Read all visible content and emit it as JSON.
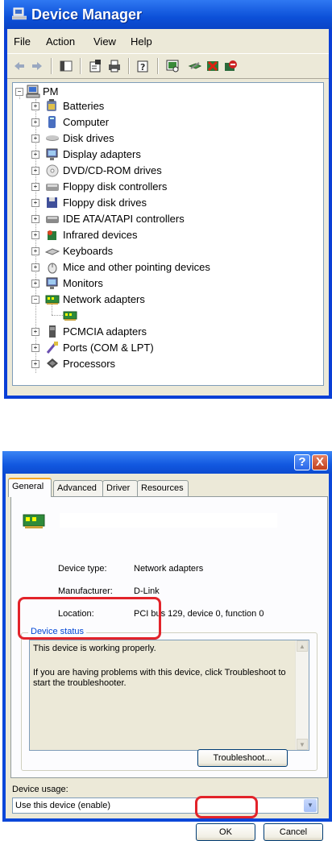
{
  "device_manager": {
    "title": "Device Manager",
    "menu": [
      "File",
      "Action",
      "View",
      "Help"
    ],
    "tree_root": "PM",
    "tree": [
      {
        "label": "Batteries",
        "icon": "battery-icon"
      },
      {
        "label": "Computer",
        "icon": "computer-icon"
      },
      {
        "label": "Disk drives",
        "icon": "disk-drive-icon"
      },
      {
        "label": "Display adapters",
        "icon": "monitor-icon"
      },
      {
        "label": "DVD/CD-ROM drives",
        "icon": "cd-drive-icon"
      },
      {
        "label": "Floppy disk controllers",
        "icon": "floppy-controller-icon"
      },
      {
        "label": "Floppy disk drives",
        "icon": "floppy-drive-icon"
      },
      {
        "label": "IDE ATA/ATAPI controllers",
        "icon": "ide-controller-icon"
      },
      {
        "label": "Infrared devices",
        "icon": "infrared-icon"
      },
      {
        "label": "Keyboards",
        "icon": "keyboard-icon"
      },
      {
        "label": "Mice and other pointing devices",
        "icon": "mouse-icon"
      },
      {
        "label": "Monitors",
        "icon": "monitor-icon"
      },
      {
        "label": "Network adapters",
        "icon": "network-card-icon"
      },
      {
        "label": "",
        "icon": "network-card-icon"
      },
      {
        "label": "PCMCIA adapters",
        "icon": "pcmcia-icon"
      },
      {
        "label": "Ports (COM & LPT)",
        "icon": "port-icon"
      },
      {
        "label": "Processors",
        "icon": "processor-icon"
      }
    ]
  },
  "properties": {
    "tabs": [
      "General",
      "Advanced",
      "Driver",
      "Resources"
    ],
    "device_type_label": "Device type:",
    "device_type": "Network adapters",
    "manufacturer_label": "Manufacturer:",
    "manufacturer": "D-Link",
    "location_label": "Location:",
    "location": "PCI bus 129, device 0, function 0",
    "status_legend": "Device status",
    "status_line1": "This device is working properly.",
    "status_line2": "If you are having problems with this device, click Troubleshoot to start the troubleshooter.",
    "troubleshoot_button": "Troubleshoot...",
    "usage_label": "Device usage:",
    "usage_value": "Use this device (enable)",
    "ok_button": "OK",
    "cancel_button": "Cancel",
    "help_glyph": "?",
    "close_glyph": "X"
  }
}
